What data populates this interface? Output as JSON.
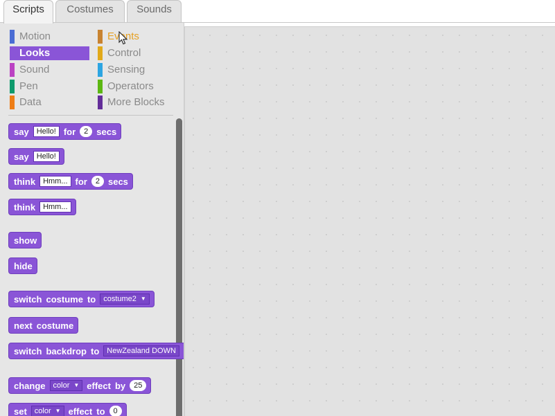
{
  "tabs": [
    {
      "label": "Scripts",
      "active": true
    },
    {
      "label": "Costumes",
      "active": false
    },
    {
      "label": "Sounds",
      "active": false
    }
  ],
  "categories": {
    "left": [
      {
        "label": "Motion",
        "color": "#4a6cd4"
      },
      {
        "label": "Looks",
        "color": "#8a55d7",
        "selected": true
      },
      {
        "label": "Sound",
        "color": "#bb42c3"
      },
      {
        "label": "Pen",
        "color": "#0e9a6c"
      },
      {
        "label": "Data",
        "color": "#ee7d16"
      }
    ],
    "right": [
      {
        "label": "Events",
        "color": "#c88330",
        "hover_text_color": "#e6a022"
      },
      {
        "label": "Control",
        "color": "#e1a91a"
      },
      {
        "label": "Sensing",
        "color": "#2ca5e2"
      },
      {
        "label": "Operators",
        "color": "#5cb712"
      },
      {
        "label": "More Blocks",
        "color": "#632d99"
      }
    ]
  },
  "blocks": {
    "say_for": {
      "w1": "say",
      "text": "Hello!",
      "w2": "for",
      "num": "2",
      "w3": "secs"
    },
    "say": {
      "w1": "say",
      "text": "Hello!"
    },
    "think_for": {
      "w1": "think",
      "text": "Hmm...",
      "w2": "for",
      "num": "2",
      "w3": "secs"
    },
    "think": {
      "w1": "think",
      "text": "Hmm..."
    },
    "show": {
      "w1": "show"
    },
    "hide": {
      "w1": "hide"
    },
    "switch_costume": {
      "w1": "switch",
      "w2": "costume",
      "w3": "to",
      "dropdown": "costume2"
    },
    "next_costume": {
      "w1": "next",
      "w2": "costume"
    },
    "switch_backdrop": {
      "w1": "switch",
      "w2": "backdrop",
      "w3": "to",
      "dropdown": "NewZealand DOWN"
    },
    "change_effect": {
      "w1": "change",
      "dropdown": "color",
      "w2": "effect",
      "w3": "by",
      "num": "25"
    },
    "set_effect": {
      "w1": "set",
      "dropdown": "color",
      "w2": "effect",
      "w3": "to",
      "num": "0"
    }
  },
  "colors": {
    "looks": "#8a55d7",
    "scripts_area": "#e2e2e2"
  }
}
